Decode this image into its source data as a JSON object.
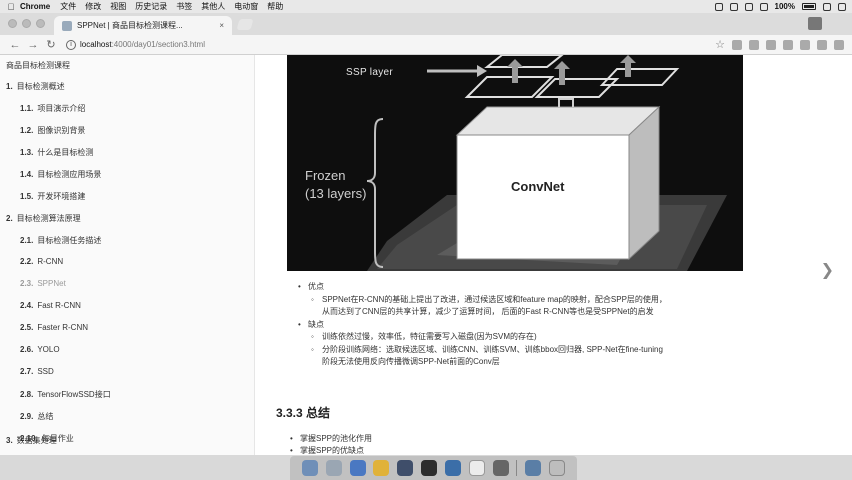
{
  "menubar": {
    "app_name": "Chrome",
    "items": [
      "文件",
      "修改",
      "视图",
      "历史记录",
      "书签",
      "其他人",
      "电动窗",
      "帮助"
    ],
    "battery": "100%"
  },
  "browser": {
    "tab_title": "SPPNet | 商品目标检测课程...",
    "tab_close": "×",
    "url_host": "localhost",
    "url_path": ":4000/day01/section3.html"
  },
  "sidebar": {
    "title": "商品目标检测课程",
    "items": [
      {
        "num": "1.",
        "label": "目标检测概述"
      },
      {
        "num": "1.1.",
        "label": "项目演示介绍"
      },
      {
        "num": "1.2.",
        "label": "图像识别背景"
      },
      {
        "num": "1.3.",
        "label": "什么是目标检测"
      },
      {
        "num": "1.4.",
        "label": "目标检测应用场景"
      },
      {
        "num": "1.5.",
        "label": "开发环境搭建"
      },
      {
        "num": "2.",
        "label": "目标检测算法原理"
      },
      {
        "num": "2.1.",
        "label": "目标检测任务描述"
      },
      {
        "num": "2.2.",
        "label": "R-CNN"
      },
      {
        "num": "2.3.",
        "label": "SPPNet"
      },
      {
        "num": "2.4.",
        "label": "Fast R-CNN"
      },
      {
        "num": "2.5.",
        "label": "Faster R-CNN"
      },
      {
        "num": "2.6.",
        "label": "YOLO"
      },
      {
        "num": "2.7.",
        "label": "SSD"
      },
      {
        "num": "2.8.",
        "label": "TensorFlowSSD接口"
      },
      {
        "num": "2.9.",
        "label": "总结"
      },
      {
        "num": "2.10.",
        "label": "每日作业"
      },
      {
        "num": "3.",
        "label": "数据集处理"
      }
    ]
  },
  "figure": {
    "ssp_label": "SSP layer",
    "frozen_line1": "Frozen",
    "frozen_line2": "(13 layers)",
    "convnet_label": "ConvNet"
  },
  "content": {
    "advantages_title": "优点",
    "advantage_1_line1": "SPPNet在R-CNN的基础上提出了改进，通过候选区域和feature map的映射，配合SPP层的使用，",
    "advantage_1_line2": "从而达到了CNN层的共享计算，减少了运算时间， 后面的Fast R-CNN等也是受SPPNet的启发",
    "disadvantages_title": "缺点",
    "disadvantage_1": "训练依然过慢，效率低，特征需要写入磁盘(因为SVM的存在)",
    "disadvantage_2_line1": "分阶段训练网络：选取候选区域、训练CNN、训练SVM、训练bbox回归器, SPP-Net在fine-tuning",
    "disadvantage_2_line2": "阶段无法使用反向传播微调SPP-Net前面的Conv层",
    "section_heading": "3.3.3 总结",
    "summary_1": "掌握SPP的池化作用",
    "summary_2": "掌握SPP的优缺点"
  },
  "colors": {
    "figure_bg": "#0e0e0e",
    "sidebar_active": "#9a9a9a",
    "page_bg": "#ffffff"
  }
}
